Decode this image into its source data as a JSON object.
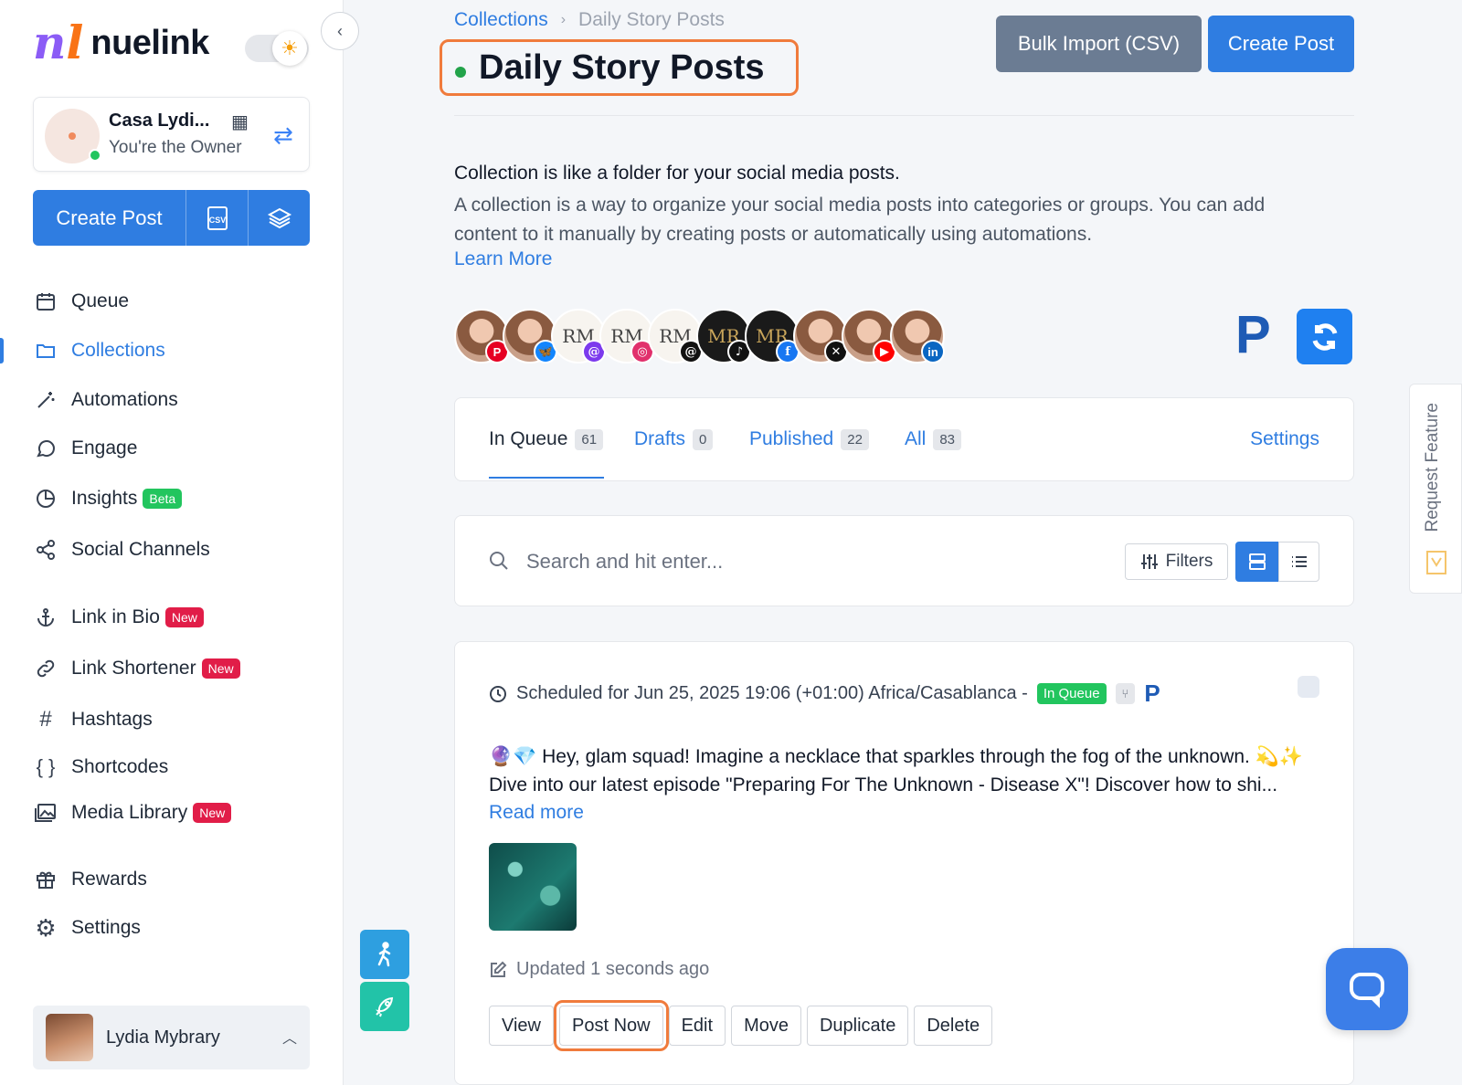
{
  "brand": {
    "name": "nuelink",
    "mark": "nl"
  },
  "workspace": {
    "name": "Casa Lydi...",
    "role": "You're the Owner"
  },
  "sidebar": {
    "create_post": "Create Post",
    "csv_label": "CSV",
    "items": [
      {
        "label": "Queue",
        "icon": "calendar-icon"
      },
      {
        "label": "Collections",
        "icon": "folder-icon",
        "active": true
      },
      {
        "label": "Automations",
        "icon": "magic-wand-icon"
      },
      {
        "label": "Engage",
        "icon": "chat-icon"
      },
      {
        "label": "Insights",
        "icon": "pie-chart-icon",
        "badge": "Beta"
      },
      {
        "label": "Social Channels",
        "icon": "share-icon"
      },
      {
        "label": "Link in Bio",
        "icon": "anchor-icon",
        "badge": "New"
      },
      {
        "label": "Link Shortener",
        "icon": "link-icon",
        "badge": "New"
      },
      {
        "label": "Hashtags",
        "icon": "hash-icon"
      },
      {
        "label": "Shortcodes",
        "icon": "braces-icon"
      },
      {
        "label": "Media Library",
        "icon": "images-icon",
        "badge": "New"
      },
      {
        "label": "Rewards",
        "icon": "gift-icon"
      },
      {
        "label": "Settings",
        "icon": "gear-icon"
      }
    ]
  },
  "user": {
    "name": "Lydia Mybrary"
  },
  "breadcrumb": {
    "parent": "Collections",
    "current": "Daily Story Posts"
  },
  "page": {
    "title": "Daily Story Posts",
    "bulk_import": "Bulk Import (CSV)",
    "create_post": "Create Post",
    "desc_line1": "Collection is like a folder for your social media posts.",
    "desc_line2": "A collection is a way to organize your social media posts into categories or groups. You can add content to it manually by creating posts or automatically using automations.",
    "learn_more": "Learn More"
  },
  "channels": {
    "avatar_text": {
      "rm": "RM",
      "mr": "MR"
    },
    "network_letters": {
      "pinterest": "P",
      "linkedin": "in"
    },
    "pinterest_logo": "P"
  },
  "tabs": [
    {
      "label": "In Queue",
      "count": "61"
    },
    {
      "label": "Drafts",
      "count": "0"
    },
    {
      "label": "Published",
      "count": "22"
    },
    {
      "label": "All",
      "count": "83"
    }
  ],
  "tabs_settings": "Settings",
  "search": {
    "placeholder": "Search and hit enter...",
    "filters": "Filters"
  },
  "post": {
    "schedule": "Scheduled for Jun 25, 2025 19:06 (+01:00) Africa/Casablanca -",
    "status": "In Queue",
    "pinterest_icon": "P",
    "text": "🔮💎 Hey, glam squad! Imagine a necklace that sparkles through the fog of the unknown. 💫✨ Dive into our latest episode \"Preparing For The Unknown - Disease X\"! Discover how to shi...",
    "read_more": "Read more",
    "updated": "Updated 1 seconds ago",
    "actions": {
      "view": "View",
      "post_now": "Post Now",
      "edit": "Edit",
      "move": "Move",
      "duplicate": "Duplicate",
      "delete": "Delete"
    }
  },
  "request_feature": "Request Feature",
  "colors": {
    "primary": "#2f7de1",
    "highlight": "#f07b3c",
    "success": "#22c55e",
    "danger": "#e11d48"
  }
}
